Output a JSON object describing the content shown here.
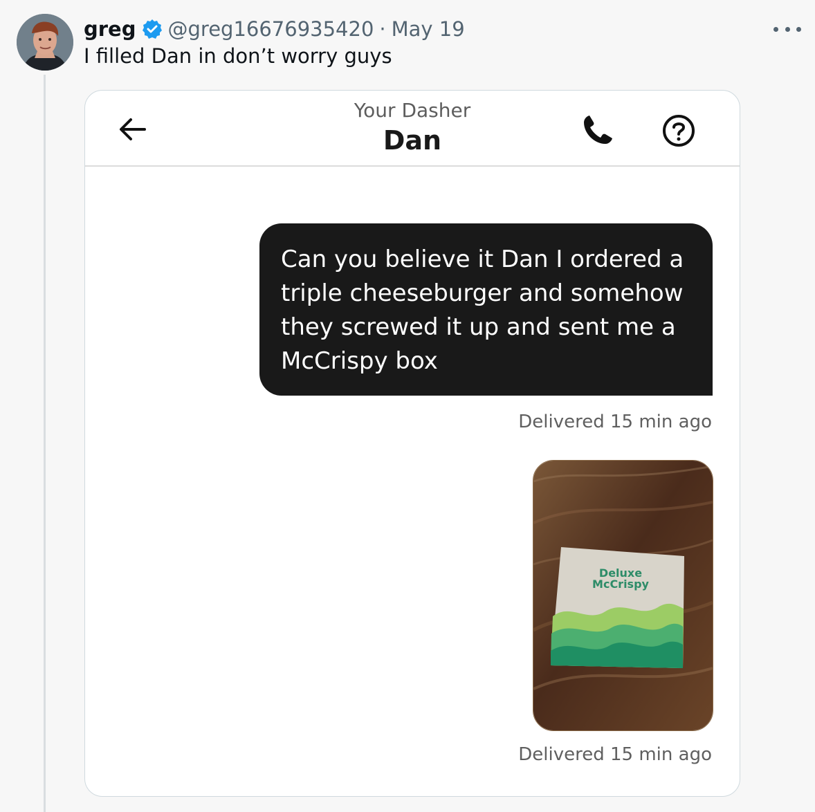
{
  "tweet": {
    "username": "greg",
    "handle": "@greg16676935420",
    "separator": "·",
    "date": "May 19",
    "text": "I filled Dan in don’t worry guys",
    "verified": true,
    "icons": [
      "avatar",
      "verified-badge-icon",
      "more-options-icon"
    ]
  },
  "chat": {
    "subtitle": "Your Dasher",
    "name": "Dan",
    "icons": [
      "back-arrow-icon",
      "phone-icon",
      "help-icon"
    ],
    "messages": [
      {
        "type": "text",
        "text": "Can you believe it Dan I ordered a triple cheeseburger and somehow they screwed it up and sent me a McCrispy box",
        "status": "Delivered 15 min ago"
      },
      {
        "type": "photo",
        "photo_box_text_line1": "Deluxe",
        "photo_box_text_line2": "McCrispy",
        "status": "Delivered 15 min ago"
      }
    ]
  },
  "colors": {
    "background": "#f7f7f7",
    "text": "#0f1419",
    "muted": "#536471",
    "verified": "#1d9bf0",
    "bubble": "#191919",
    "card_border": "#cfd9de"
  }
}
